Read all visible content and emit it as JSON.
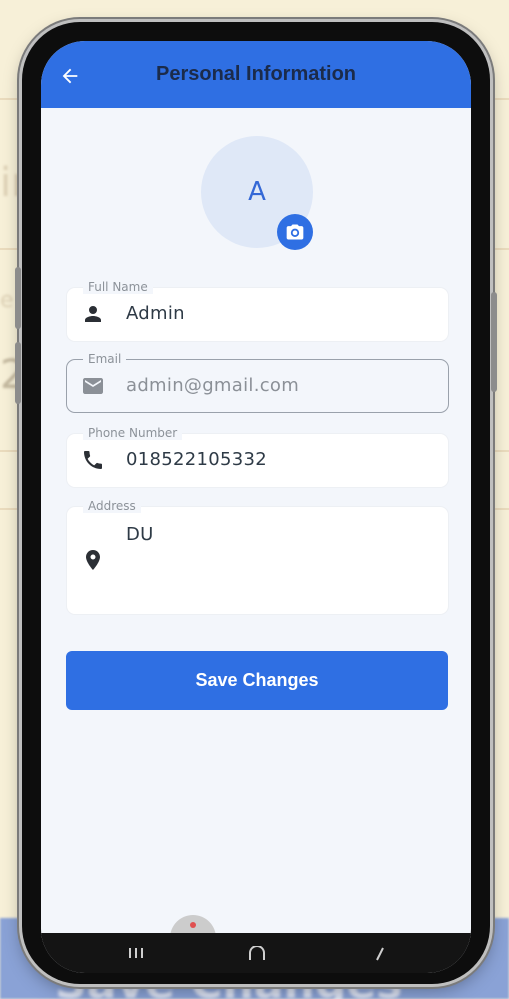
{
  "app": {
    "title": "Personal Information",
    "avatar_initial": "A"
  },
  "fields": [
    {
      "label": "Full Name",
      "value": "Admin",
      "icon": "person-icon",
      "state": "filled"
    },
    {
      "label": "Email",
      "value": "admin@gmail.com",
      "icon": "mail-icon",
      "state": "disabled-outlined"
    },
    {
      "label": "Phone Number",
      "value": "018522105332",
      "icon": "phone-icon",
      "state": "filled"
    },
    {
      "label": "Address",
      "value": "DU",
      "icon": "location-pin-icon",
      "state": "filled-multiline"
    }
  ],
  "save_button": {
    "label": "Save Changes"
  },
  "background": {
    "partial_texts": [
      "ir",
      "e",
      "2"
    ],
    "bottom_text": "Save Changes"
  },
  "colors": {
    "primary": "#2f6fe3",
    "screen_bg": "#f3f6fb",
    "avatar_bg": "#dfe8f7",
    "title_text": "#1b2b4a",
    "page_bg": "#f7f0d8"
  },
  "nav": {
    "recents_icon": "recents-icon",
    "home_icon": "home-icon",
    "back_icon": "back-nav-icon"
  }
}
